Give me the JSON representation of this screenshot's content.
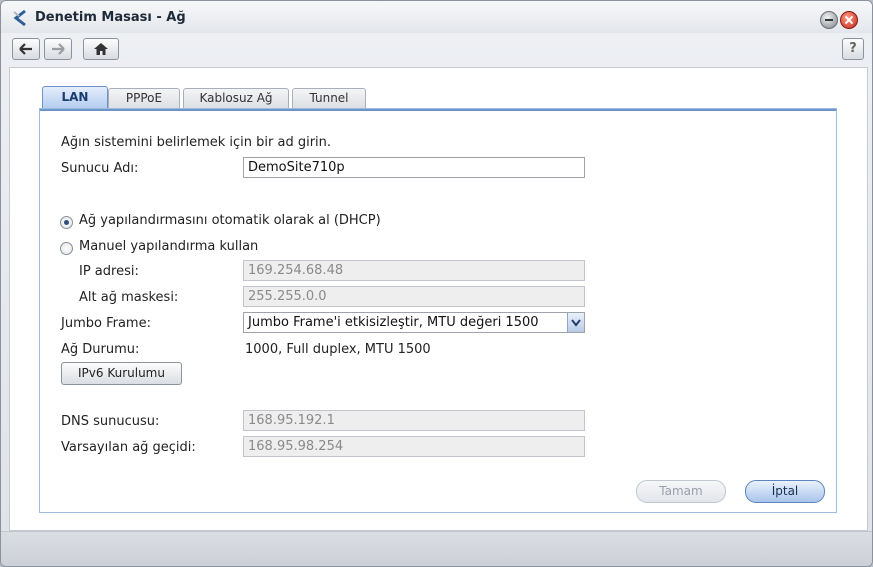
{
  "window": {
    "title": "Denetim Masası - Ağ"
  },
  "toolbar": {
    "help_label": "?"
  },
  "tabs": [
    {
      "label": "LAN",
      "active": true
    },
    {
      "label": "PPPoE",
      "active": false
    },
    {
      "label": "Kablosuz Ağ",
      "active": false
    },
    {
      "label": "Tunnel",
      "active": false
    }
  ],
  "form": {
    "intro": "Ağın sistemini belirlemek için bir ad girin.",
    "server_name_label": "Sunucu Adı:",
    "server_name_value": "DemoSite710p",
    "dhcp_label": "Ağ yapılandırmasını otomatik olarak al (DHCP)",
    "manual_label": "Manuel yapılandırma kullan",
    "ip_label": "IP adresi:",
    "ip_value": "169.254.68.48",
    "subnet_label": "Alt ağ maskesi:",
    "subnet_value": "255.255.0.0",
    "jumbo_label": "Jumbo Frame:",
    "jumbo_value": "Jumbo Frame'i etkisizleştir, MTU değeri 1500",
    "status_label": "Ağ Durumu:",
    "status_value": "1000, Full duplex, MTU 1500",
    "ipv6_button": "IPv6 Kurulumu",
    "dns_label": "DNS sunucusu:",
    "dns_value": "168.95.192.1",
    "gateway_label": "Varsayılan ağ geçidi:",
    "gateway_value": "168.95.98.254"
  },
  "buttons": {
    "ok": "Tamam",
    "cancel": "İptal"
  },
  "colors": {
    "accent": "#6d93c8",
    "close": "#c0281a"
  }
}
